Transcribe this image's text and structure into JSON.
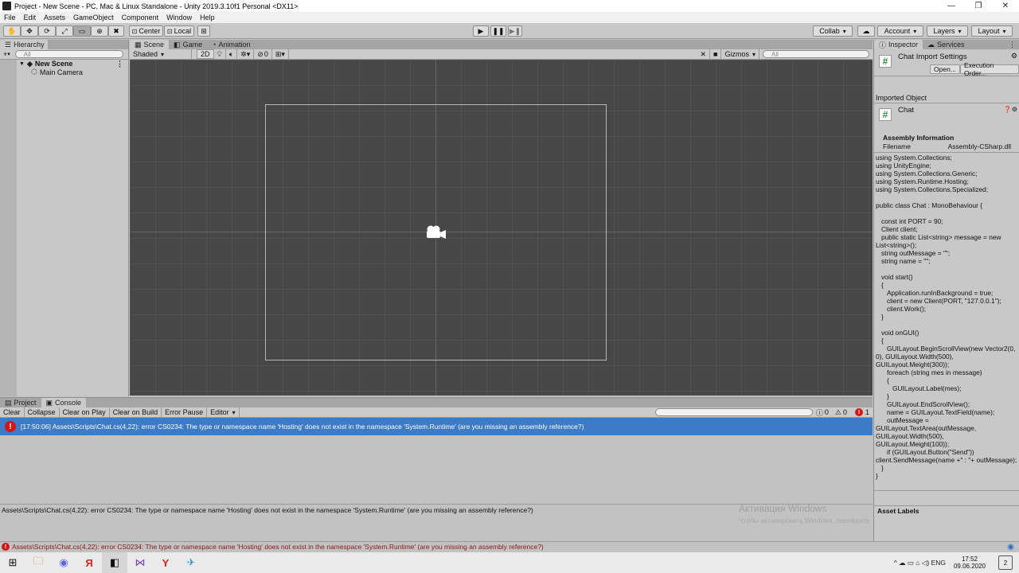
{
  "window": {
    "title": "Project - New Scene - PC, Mac & Linux Standalone - Unity 2019.3.10f1 Personal <DX11>",
    "controls": [
      "—",
      "❐",
      "✕"
    ]
  },
  "menu": [
    "File",
    "Edit",
    "Assets",
    "GameObject",
    "Component",
    "Window",
    "Help"
  ],
  "toolbar": {
    "tools": [
      "✋",
      "✥",
      "⟳",
      "⤢",
      "▭",
      "⊕",
      "✖"
    ],
    "pivot": "Center",
    "space": "Local",
    "play_icons": [
      "▶",
      "❚❚",
      "▶❚"
    ],
    "collab": "Collab",
    "account": "Account",
    "layers": "Layers",
    "layout": "Layout"
  },
  "hierarchy": {
    "tab": "Hierarchy",
    "add": "+",
    "search_placeholder": "All",
    "scene": "New Scene",
    "items": [
      "Main Camera"
    ]
  },
  "scene_tabs": [
    "Scene",
    "Game",
    "Animation"
  ],
  "scene_toolbar": {
    "shading": "Shaded",
    "mode_2d": "2D",
    "fx_count": "0",
    "gizmos": "Gizmos",
    "search_placeholder": "All"
  },
  "bottom_tabs": [
    "Project",
    "Console"
  ],
  "console": {
    "buttons": [
      "Clear",
      "Collapse",
      "Clear on Play",
      "Clear on Build",
      "Error Pause",
      "Editor"
    ],
    "counts": {
      "info": "0",
      "warning": "0",
      "error": "1"
    },
    "message": "[17:50:06] Assets\\Scripts\\Chat.cs(4,22): error CS0234: The type or namespace name 'Hosting' does not exist in the namespace 'System.Runtime' (are you missing an assembly reference?)",
    "detail": "Assets\\Scripts\\Chat.cs(4,22): error CS0234: The type or namespace name 'Hosting' does not exist in the namespace 'System.Runtime' (are you missing an assembly reference?)"
  },
  "status_bar": "Assets\\Scripts\\Chat.cs(4,22): error CS0234: The type or namespace name 'Hosting' does not exist in the namespace 'System.Runtime' (are you missing an assembly reference?)",
  "watermark": {
    "line1": "Активация Windows",
    "line2": "Чтобы активировать Windows, перейдите в раздел \"Параметры\"."
  },
  "inspector": {
    "tabs": [
      "Inspector",
      "Services"
    ],
    "header_title": "Chat Import Settings",
    "open_button": "Open...",
    "exec_order_button": "Execution Order...",
    "imported_object_label": "Imported Object",
    "object_name": "Chat",
    "assembly_title": "Assembly Information",
    "filename_label": "Filename",
    "filename_value": "Assembly-CSharp.dll",
    "code": "using System.Collections;\nusing UnityEngine;\nusing System.Collections.Generic;\nusing System.Runtime.Hosting;\nusing System.Collections.Specialized;\n\npublic class Chat : MonoBehaviour {\n\n   const int PORT = 90;\n   Client client;\n   public static List<string> message = new List<string>();\n   string outMessage = \"\";\n   string name = \"\";\n\n   void start()\n   {\n      Application.runInBackground = true;\n      client = new Client(PORT, \"127.0.0.1\");\n      client.Work();\n   }\n\n   void onGUI()\n   {\n      GUILayout.BeginScrollView(new Vector2(0, 0), GUILayout.Width(500), GUILayout.Meight(300));\n      foreach (string mes in message)\n      {\n         GUILayout.Label(mes);\n      }\n      GUILayout.EndScrollView();\n      name = GUILayout.TextField(name);\n      outMessage = GUILayout.TextArea(outMessage, GUILayout.Width(500), GUILayout.Meight(100));\n      if (GUILayout.Button(\"Send\"))\nclient.SendMessage(name +\" : \"+ outMessage);\n   }\n}",
    "asset_labels": "Asset Labels"
  },
  "taskbar": {
    "apps": [
      "⊞",
      "🔍︎",
      "▭",
      "🗀",
      "◉",
      "Я",
      "◧",
      "⋈",
      "Y",
      "✈"
    ],
    "tray": "^ ☁ ▭ ⌂ ◁) ENG",
    "time": "17:52",
    "date": "09.06.2020",
    "notif": "2"
  },
  "colors": {
    "selection": "#3d7ac8",
    "error": "#d01818",
    "scene_bg": "#474747"
  }
}
